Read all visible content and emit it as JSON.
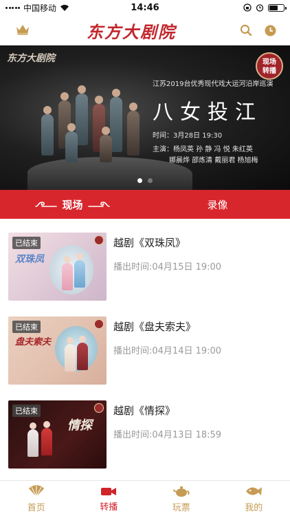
{
  "status_bar": {
    "carrier": "中国移动",
    "time": "14:46"
  },
  "header": {
    "title": "东方大剧院",
    "crown_icon": "crown-icon",
    "search_icon": "search-icon",
    "clock_icon": "clock-icon"
  },
  "banner": {
    "logo": "东方大剧院",
    "badge_line1": "现场",
    "badge_line2": "转播",
    "subtitle": "江苏2019台优秀现代戏大运河沿岸巡演",
    "main_title": "八女投江",
    "time_line": "时间：3月28日 19:30",
    "cast_line1": "主演：杨凤英 孙 静 冯 悦 朱红英",
    "cast_line2": "娜晨烨 邵炼清 戴丽君 杨旭梅",
    "slide_count": 2,
    "active_slide": 0
  },
  "tabs": [
    {
      "label": "现场",
      "active": true
    },
    {
      "label": "录像",
      "active": false
    }
  ],
  "items": [
    {
      "title": "越剧《双珠凤》",
      "time": "播出时间:04月15日 19:00",
      "ended": "已结束",
      "thumb_text": "双珠凤"
    },
    {
      "title": "越剧《盘夫索夫》",
      "time": "播出时间:04月14日 19:00",
      "ended": "已结束",
      "thumb_text": "盘夫索夫"
    },
    {
      "title": "越剧《情探》",
      "time": "播出时间:04月13日 18:59",
      "ended": "已结束",
      "thumb_text": "情探"
    }
  ],
  "bottom_nav": [
    {
      "label": "首页",
      "icon": "fan-icon",
      "active": false
    },
    {
      "label": "转播",
      "icon": "video-camera-icon",
      "active": true
    },
    {
      "label": "玩票",
      "icon": "teapot-icon",
      "active": false
    },
    {
      "label": "我的",
      "icon": "fish-icon",
      "active": false
    }
  ],
  "colors": {
    "brand_red": "#d8262d",
    "gold": "#c69b53",
    "text_gray": "#999999"
  }
}
